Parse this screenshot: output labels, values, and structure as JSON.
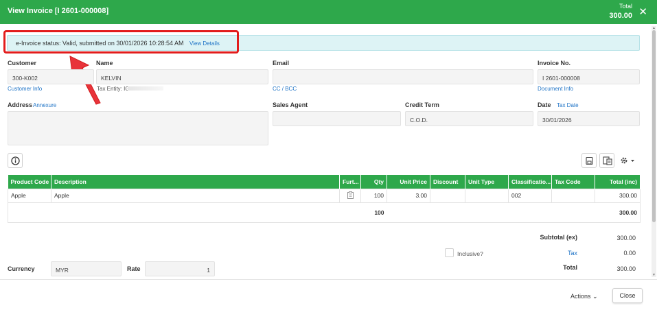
{
  "header": {
    "title": "View Invoice [I 2601-000008]",
    "total_label": "Total",
    "total_value": "300.00",
    "close_icon": "close-icon"
  },
  "einvoice": {
    "status_text": "e-Invoice status: Valid, submitted on 30/01/2026 10:28:54 AM",
    "view_details": "View Details"
  },
  "customer": {
    "label": "Customer",
    "value": "300-K002",
    "link": "Customer Info"
  },
  "name": {
    "label": "Name",
    "value": "KELVIN",
    "tax_entity": "Tax Entity: IG2"
  },
  "email": {
    "label": "Email",
    "value": "",
    "link": "CC / BCC"
  },
  "invoice_no": {
    "label": "Invoice No.",
    "value": "I 2601-000008",
    "link": "Document Info"
  },
  "address": {
    "label": "Address",
    "link": "Annexure",
    "value": ""
  },
  "sales_agent": {
    "label": "Sales Agent",
    "value": ""
  },
  "credit_term": {
    "label": "Credit Term",
    "value": "C.O.D."
  },
  "date": {
    "label": "Date",
    "link": "Tax Date",
    "value": "30/01/2026"
  },
  "toolbar": {
    "info_icon": "info-icon",
    "save_icon": "save-icon",
    "copy_icon": "copy-document-icon",
    "gear_icon": "gear-icon"
  },
  "table": {
    "headers": [
      "Product Code",
      "Description",
      "Furt...",
      "Qty",
      "Unit Price",
      "Discount",
      "Unit Type",
      "Classificatio...",
      "Tax Code",
      "Total (inc)"
    ],
    "rows": [
      {
        "product_code": "Apple",
        "description": "Apple",
        "qty": "100",
        "unit_price": "3.00",
        "discount": "",
        "unit_type": "",
        "classification": "002",
        "tax_code": "",
        "total": "300.00"
      }
    ],
    "total_qty": "100",
    "total_amount": "300.00"
  },
  "summary": {
    "subtotal_label": "Subtotal (ex)",
    "subtotal_value": "300.00",
    "inclusive_label": "Inclusive?",
    "tax_label": "Tax",
    "tax_value": "0.00",
    "total_label": "Total",
    "total_value": "300.00"
  },
  "currency": {
    "label": "Currency",
    "value": "MYR"
  },
  "rate": {
    "label": "Rate",
    "value": "1"
  },
  "footer": {
    "actions_label": "Actions",
    "close_label": "Close"
  },
  "colors": {
    "primary_green": "#2ea84b",
    "link_blue": "#1e73c6",
    "highlight_red": "#e21c1c",
    "status_bg": "#ddf3f5"
  }
}
